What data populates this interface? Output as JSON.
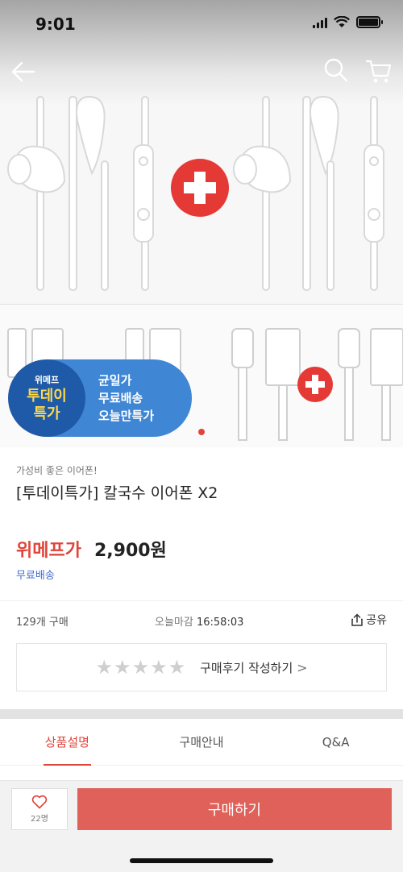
{
  "status_bar": {
    "time": "9:01"
  },
  "header": {
    "back": "back-arrow-icon",
    "search": "search-icon",
    "cart": "cart-icon"
  },
  "promo_badge": {
    "brand": "위메프",
    "line1": "투데이",
    "line2": "특가",
    "benefit1": "균일가",
    "benefit2": "무료배송",
    "benefit3": "오늘만특가"
  },
  "product": {
    "subtitle": "가성비 좋은 이어폰!",
    "title": "[투데이특가] 칼국수 이어폰 X2",
    "price_label": "위메프가",
    "price": "2,900원",
    "shipping": "무료배송"
  },
  "stats": {
    "buy_count": "129개 구매",
    "deadline_label": "오늘마감",
    "deadline_time": "16:58:03",
    "share_label": "공유"
  },
  "review": {
    "label": "구매후기 작성하기",
    "chevron": ">"
  },
  "tabs": [
    {
      "label": "상품설명"
    },
    {
      "label": "구매안내"
    },
    {
      "label": "Q&A"
    }
  ],
  "bottom": {
    "like_count": "22명",
    "buy_label": "구매하기"
  },
  "colors": {
    "accent": "#e0443a",
    "buy_button": "#e0605a",
    "shipping": "#3f6fd0",
    "badge_dark": "#1e5aa8",
    "badge_light": "#3f86d4"
  }
}
